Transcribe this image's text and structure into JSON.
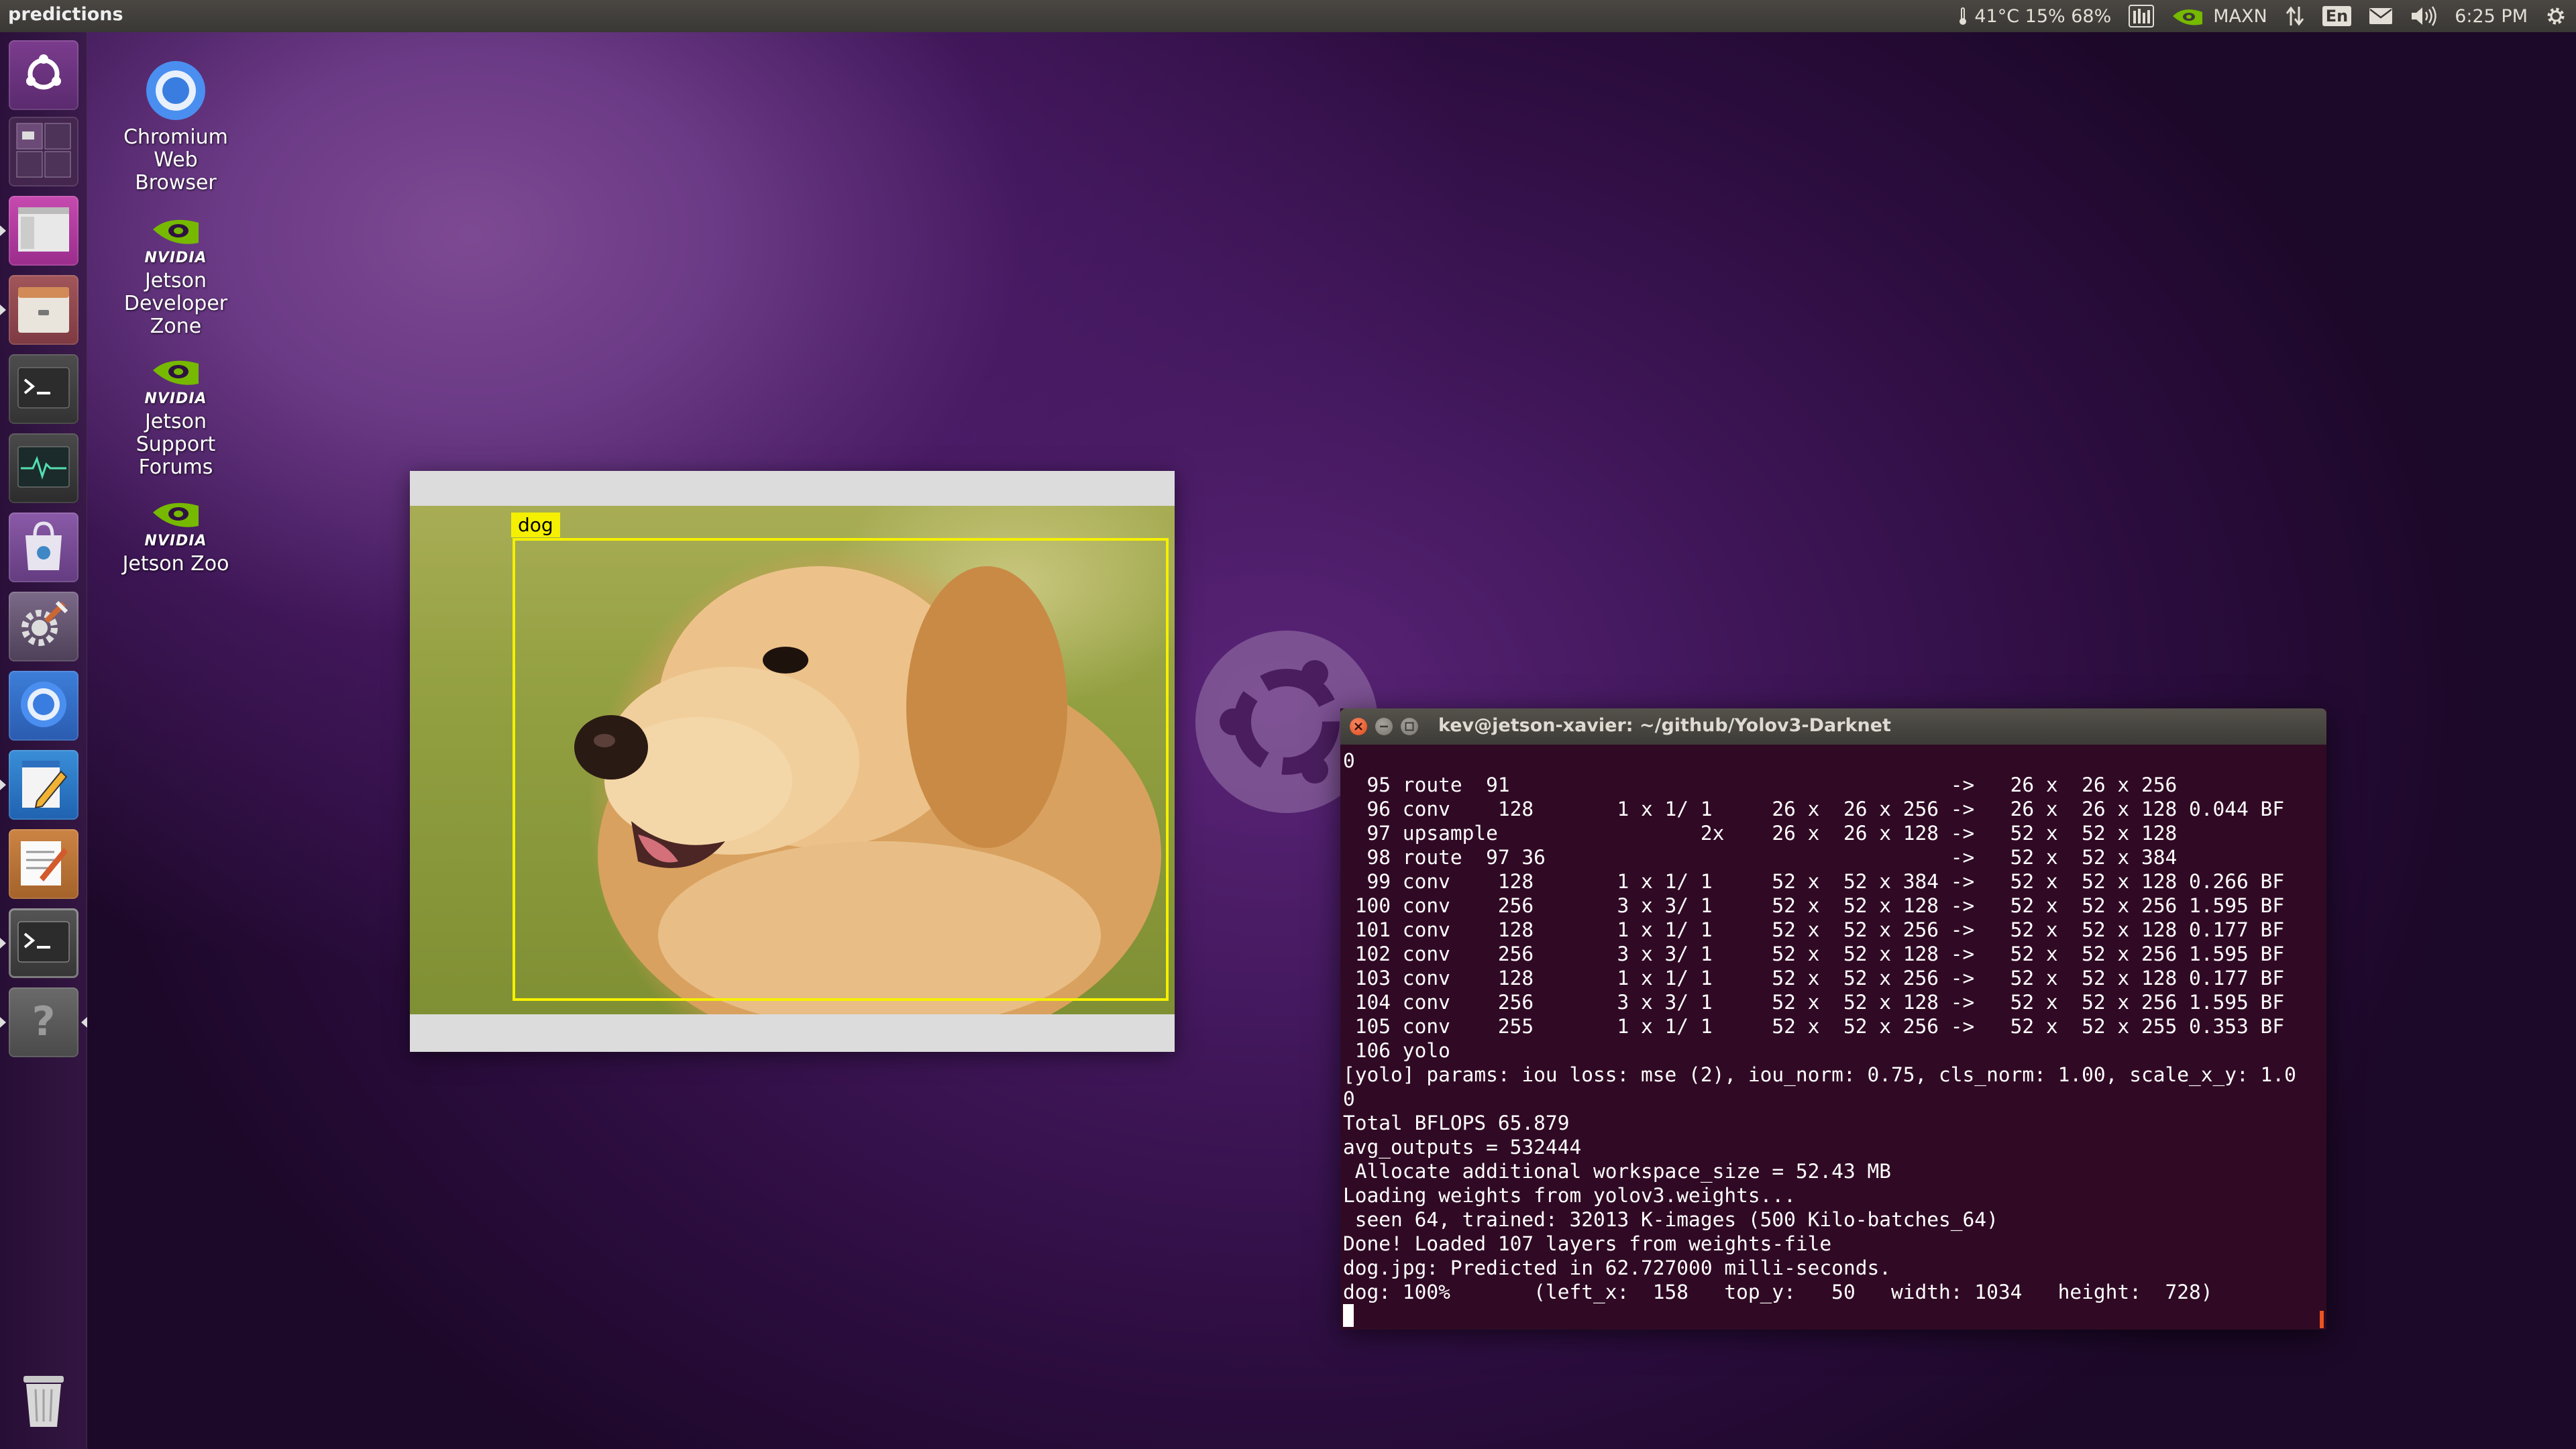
{
  "top_panel": {
    "app_title": "predictions",
    "status": "41°C 15% 68%",
    "power_mode": "MAXN",
    "keyboard_layout": "En",
    "clock": "6:25 PM"
  },
  "launcher": {
    "items": [
      {
        "name": "ubuntu-dash",
        "icon": "ubuntu-dash-icon"
      },
      {
        "name": "workspace-switcher",
        "icon": "workspaces-icon"
      },
      {
        "name": "predictions-window",
        "icon": "image-window-icon"
      },
      {
        "name": "files",
        "icon": "files-icon"
      },
      {
        "name": "terminal",
        "icon": "terminal-icon"
      },
      {
        "name": "system-monitor",
        "icon": "system-monitor-icon"
      },
      {
        "name": "software-center",
        "icon": "software-center-icon"
      },
      {
        "name": "system-settings",
        "icon": "settings-icon"
      },
      {
        "name": "chromium",
        "icon": "chromium-icon"
      },
      {
        "name": "text-editor",
        "icon": "text-editor-icon"
      },
      {
        "name": "notes",
        "icon": "notes-icon"
      },
      {
        "name": "terminal-active",
        "icon": "terminal-icon"
      },
      {
        "name": "help",
        "icon": "help-icon"
      },
      {
        "name": "trash",
        "icon": "trash-icon"
      }
    ]
  },
  "desktop_icons": [
    {
      "label_lines": [
        "Chromium",
        "Web",
        "Browser"
      ],
      "icon": "chromium-icon"
    },
    {
      "brand": "NVIDIA",
      "label_lines": [
        "Jetson",
        "Developer",
        "Zone"
      ],
      "icon": "nvidia-icon"
    },
    {
      "brand": "NVIDIA",
      "label_lines": [
        "Jetson",
        "Support",
        "Forums"
      ],
      "icon": "nvidia-icon"
    },
    {
      "brand": "NVIDIA",
      "label_lines": [
        "Jetson Zoo"
      ],
      "icon": "nvidia-icon"
    }
  ],
  "predictions": {
    "label": "dog",
    "box_color": "#f5f000"
  },
  "terminal": {
    "title": "kev@jetson-xavier: ~/github/Yolov3-Darknet",
    "lines": [
      "0",
      "  95 route  91                                     ->   26 x  26 x 256",
      "  96 conv    128       1 x 1/ 1     26 x  26 x 256 ->   26 x  26 x 128 0.044 BF",
      "  97 upsample                 2x    26 x  26 x 128 ->   52 x  52 x 128",
      "  98 route  97 36                                  ->   52 x  52 x 384",
      "  99 conv    128       1 x 1/ 1     52 x  52 x 384 ->   52 x  52 x 128 0.266 BF",
      " 100 conv    256       3 x 3/ 1     52 x  52 x 128 ->   52 x  52 x 256 1.595 BF",
      " 101 conv    128       1 x 1/ 1     52 x  52 x 256 ->   52 x  52 x 128 0.177 BF",
      " 102 conv    256       3 x 3/ 1     52 x  52 x 128 ->   52 x  52 x 256 1.595 BF",
      " 103 conv    128       1 x 1/ 1     52 x  52 x 256 ->   52 x  52 x 128 0.177 BF",
      " 104 conv    256       3 x 3/ 1     52 x  52 x 128 ->   52 x  52 x 256 1.595 BF",
      " 105 conv    255       1 x 1/ 1     52 x  52 x 256 ->   52 x  52 x 255 0.353 BF",
      " 106 yolo",
      "[yolo] params: iou loss: mse (2), iou_norm: 0.75, cls_norm: 1.00, scale_x_y: 1.0",
      "0",
      "Total BFLOPS 65.879",
      "avg_outputs = 532444",
      " Allocate additional workspace_size = 52.43 MB",
      "Loading weights from yolov3.weights...",
      " seen 64, trained: 32013 K-images (500 Kilo-batches_64)",
      "Done! Loaded 107 layers from weights-file",
      "dog.jpg: Predicted in 62.727000 milli-seconds.",
      "dog: 100%       (left_x:  158   top_y:   50   width: 1034   height:  728)"
    ]
  },
  "colors": {
    "terminal_bg": "#300a24",
    "ubuntu_orange": "#e95420",
    "nvidia_green": "#76b900"
  }
}
